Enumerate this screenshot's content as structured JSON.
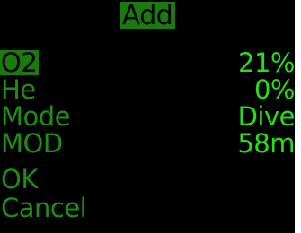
{
  "header": {
    "title": "Add"
  },
  "menu": {
    "items": [
      {
        "label": "O2",
        "value": "21%",
        "selected": true
      },
      {
        "label": "He",
        "value": "0%",
        "selected": false
      },
      {
        "label": "Mode",
        "value": "Dive",
        "selected": false
      },
      {
        "label": "MOD",
        "value": "58m",
        "selected": false
      },
      {
        "label": "OK",
        "value": "",
        "selected": false
      },
      {
        "label": "Cancel",
        "value": "",
        "selected": false
      }
    ]
  },
  "colors": {
    "screen_background": "#000000",
    "highlight_background": "#1a7a0e",
    "label_text": "#1e8f10",
    "value_text": "#25e012",
    "highlight_text": "#000000"
  }
}
